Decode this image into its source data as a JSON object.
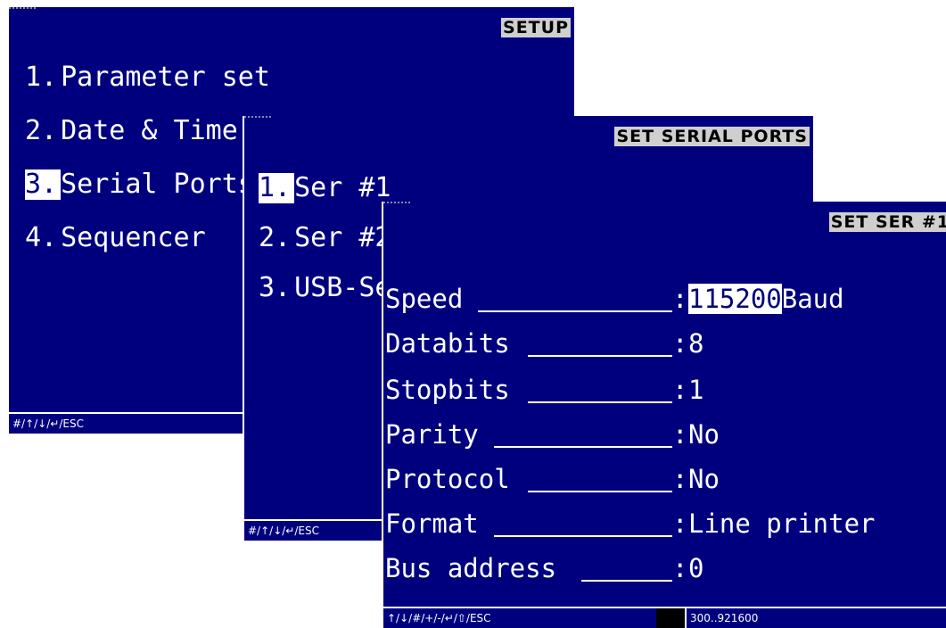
{
  "setup": {
    "title": "SETUP",
    "items": [
      {
        "num": "1.",
        "label": "Parameter set"
      },
      {
        "num": "2.",
        "label": "Date & Time"
      },
      {
        "num": "3.",
        "label": "Serial Ports"
      },
      {
        "num": "4.",
        "label": "Sequencer"
      }
    ],
    "footer": "#/↑/↓/↵/ESC"
  },
  "serial_ports": {
    "title": "SET SERIAL PORTS",
    "items": [
      {
        "num": "1.",
        "label": "Ser #1"
      },
      {
        "num": "2.",
        "label": "Ser #2"
      },
      {
        "num": "3.",
        "label": "USB-Ser"
      }
    ],
    "footer": "#/↑/↓/↵/ESC"
  },
  "ser1": {
    "title": "SET SER #1",
    "fields": [
      {
        "label": "Speed",
        "value": "115200",
        "unit": "Baud"
      },
      {
        "label": "Databits",
        "value": "8"
      },
      {
        "label": "Stopbits",
        "value": "1"
      },
      {
        "label": "Parity",
        "value": "No"
      },
      {
        "label": "Protocol",
        "value": "No"
      },
      {
        "label": "Format",
        "value": "Line printer"
      },
      {
        "label": "Bus address",
        "value": "0"
      }
    ],
    "colon": ":",
    "footer_keys": "↑/↓/#/+/-/↵/⇧/ESC",
    "footer_range": "300..921600"
  },
  "colors": {
    "screen_bg": "#00007f",
    "title_bg": "#cfcfcf",
    "highlight_bg": "#ffffff"
  }
}
